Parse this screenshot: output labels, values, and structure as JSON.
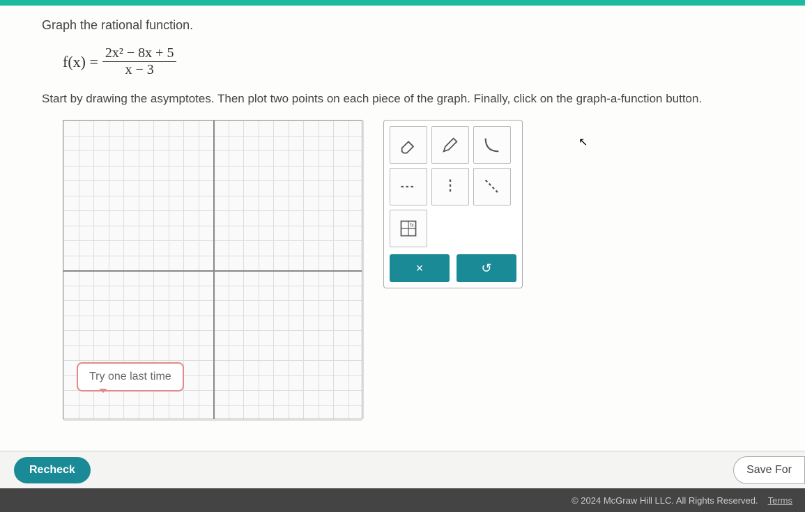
{
  "question": {
    "title": "Graph the rational function.",
    "equation": {
      "lhs": "f(x) =",
      "numerator": "2x² − 8x + 5",
      "denominator": "x − 3"
    },
    "instructions": "Start by drawing the asymptotes. Then plot two points on each piece of the graph. Finally, click on the graph-a-function button."
  },
  "tools": {
    "eraser": "eraser-icon",
    "pencil": "pencil-icon",
    "curve": "curve-icon",
    "dashed_h": "dashed-horizontal-icon",
    "dashed_v": "dashed-vertical-icon",
    "dashed_diag": "dashed-diagonal-icon",
    "grid_chart": "graph-function-icon"
  },
  "actions": {
    "clear": "×",
    "undo": "↺"
  },
  "callout": "Try one last time",
  "buttons": {
    "recheck": "Recheck",
    "save_for": "Save For"
  },
  "footer": {
    "copyright": "© 2024 McGraw Hill LLC. All Rights Reserved.",
    "terms": "Terms"
  }
}
